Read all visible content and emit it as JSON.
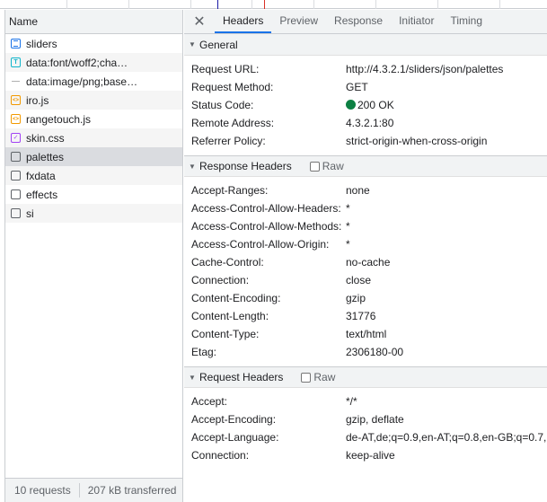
{
  "requests": [
    {
      "label": "sliders",
      "icon": "document-icon",
      "cls": "fi-doc",
      "glyph": ""
    },
    {
      "label": "data:font/woff2;cha…",
      "icon": "font-icon",
      "cls": "fi-font",
      "glyph": "T"
    },
    {
      "label": "data:image/png;base…",
      "icon": "image-icon",
      "cls": "fi-img",
      "glyph": ""
    },
    {
      "label": "iro.js",
      "icon": "script-icon",
      "cls": "fi-js",
      "glyph": "<>"
    },
    {
      "label": "rangetouch.js",
      "icon": "script-icon",
      "cls": "fi-js",
      "glyph": "<>"
    },
    {
      "label": "skin.css",
      "icon": "stylesheet-icon",
      "cls": "fi-css",
      "glyph": "✓"
    },
    {
      "label": "palettes",
      "icon": "xhr-icon",
      "cls": "fi-plain",
      "glyph": "",
      "selected": true
    },
    {
      "label": "fxdata",
      "icon": "xhr-icon",
      "cls": "fi-plain",
      "glyph": ""
    },
    {
      "label": "effects",
      "icon": "xhr-icon",
      "cls": "fi-plain",
      "glyph": ""
    },
    {
      "label": "si",
      "icon": "xhr-icon",
      "cls": "fi-plain",
      "glyph": ""
    }
  ],
  "left": {
    "column_header": "Name",
    "footer_requests": "10 requests",
    "footer_transferred": "207 kB transferred"
  },
  "tabs": [
    "Headers",
    "Preview",
    "Response",
    "Initiator",
    "Timing"
  ],
  "close_glyph": "✕",
  "sections": {
    "general": {
      "title": "General",
      "rows": [
        {
          "k": "Request URL:",
          "v": "http://4.3.2.1/sliders/json/palettes"
        },
        {
          "k": "Request Method:",
          "v": "GET"
        },
        {
          "k": "Status Code:",
          "v": "200 OK",
          "status": true
        },
        {
          "k": "Remote Address:",
          "v": "4.3.2.1:80"
        },
        {
          "k": "Referrer Policy:",
          "v": "strict-origin-when-cross-origin"
        }
      ]
    },
    "response": {
      "title": "Response Headers",
      "raw_label": "Raw",
      "rows": [
        {
          "k": "Accept-Ranges:",
          "v": "none"
        },
        {
          "k": "Access-Control-Allow-Headers:",
          "v": "*"
        },
        {
          "k": "Access-Control-Allow-Methods:",
          "v": "*"
        },
        {
          "k": "Access-Control-Allow-Origin:",
          "v": "*"
        },
        {
          "k": "Cache-Control:",
          "v": "no-cache"
        },
        {
          "k": "Connection:",
          "v": "close"
        },
        {
          "k": "Content-Encoding:",
          "v": "gzip"
        },
        {
          "k": "Content-Length:",
          "v": "31776"
        },
        {
          "k": "Content-Type:",
          "v": "text/html"
        },
        {
          "k": "Etag:",
          "v": "2306180-00"
        }
      ]
    },
    "request": {
      "title": "Request Headers",
      "raw_label": "Raw",
      "rows": [
        {
          "k": "Accept:",
          "v": "*/*"
        },
        {
          "k": "Accept-Encoding:",
          "v": "gzip, deflate"
        },
        {
          "k": "Accept-Language:",
          "v": "de-AT,de;q=0.9,en-AT;q=0.8,en-GB;q=0.7,"
        },
        {
          "k": "Connection:",
          "v": "keep-alive"
        }
      ]
    }
  }
}
